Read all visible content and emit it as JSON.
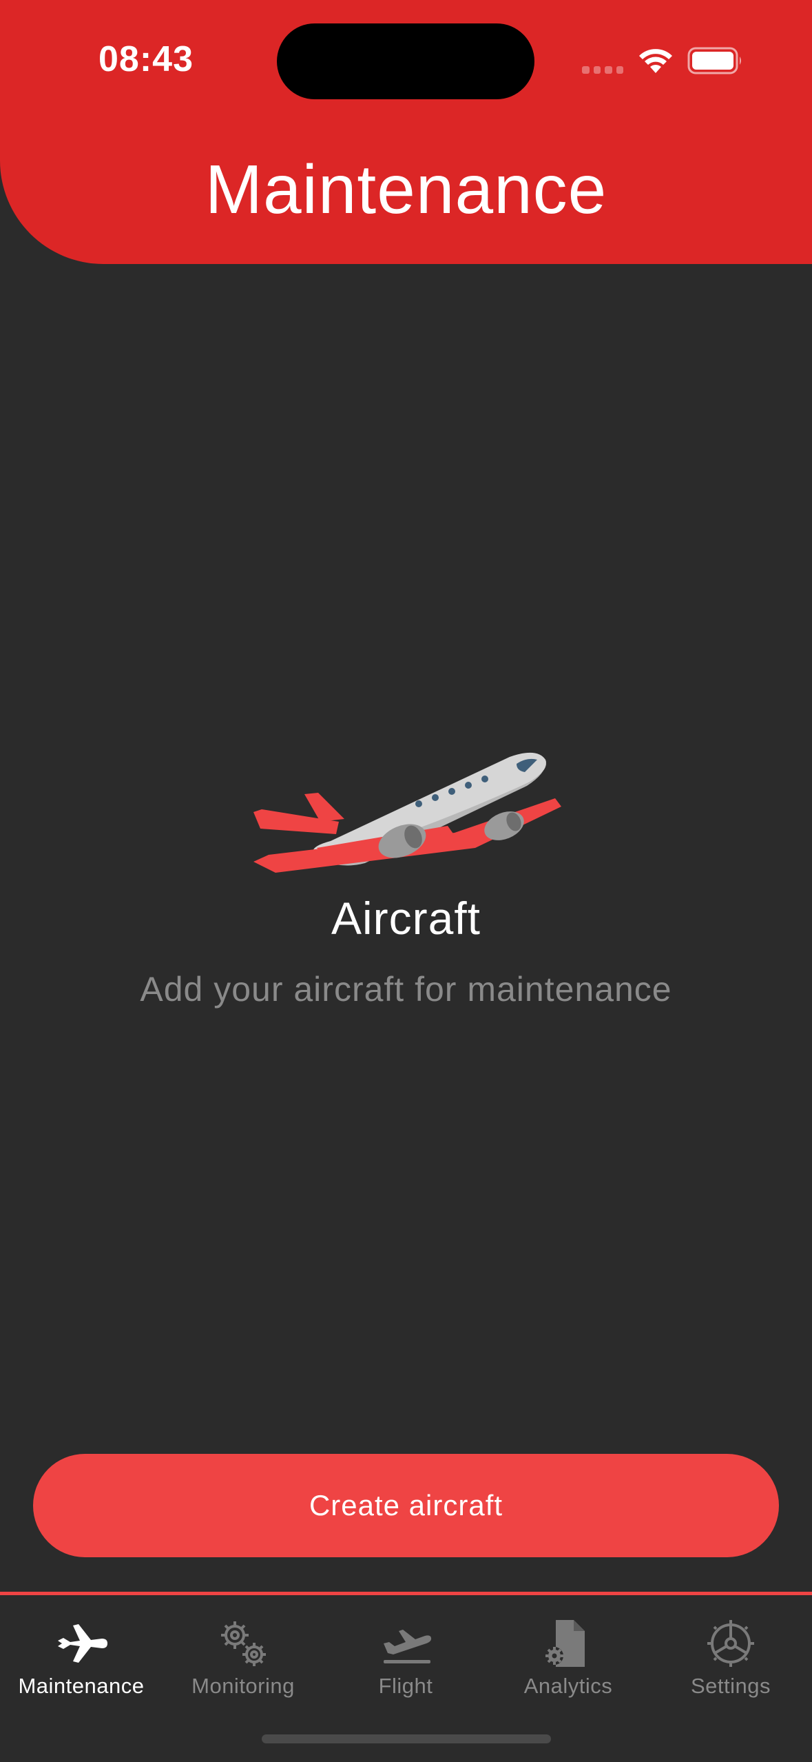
{
  "status_bar": {
    "time": "08:43",
    "wifi_icon": "wifi-icon",
    "battery_icon": "battery-icon"
  },
  "header": {
    "title": "Maintenance",
    "background_color": "#dc2626"
  },
  "empty_state": {
    "illustration_icon": "airplane-icon",
    "title": "Aircraft",
    "subtitle": "Add your aircraft for maintenance"
  },
  "primary_action": {
    "label": "Create aircraft",
    "color": "#ef4444"
  },
  "tabbar": {
    "active_index": 0,
    "items": [
      {
        "label": "Maintenance",
        "icon": "airplane-icon"
      },
      {
        "label": "Monitoring",
        "icon": "gears-icon"
      },
      {
        "label": "Flight",
        "icon": "flight-departure-icon"
      },
      {
        "label": "Analytics",
        "icon": "document-gear-icon"
      },
      {
        "label": "Settings",
        "icon": "settings-icon"
      }
    ],
    "active_color": "#ffffff",
    "inactive_color": "#8a8a8a"
  }
}
